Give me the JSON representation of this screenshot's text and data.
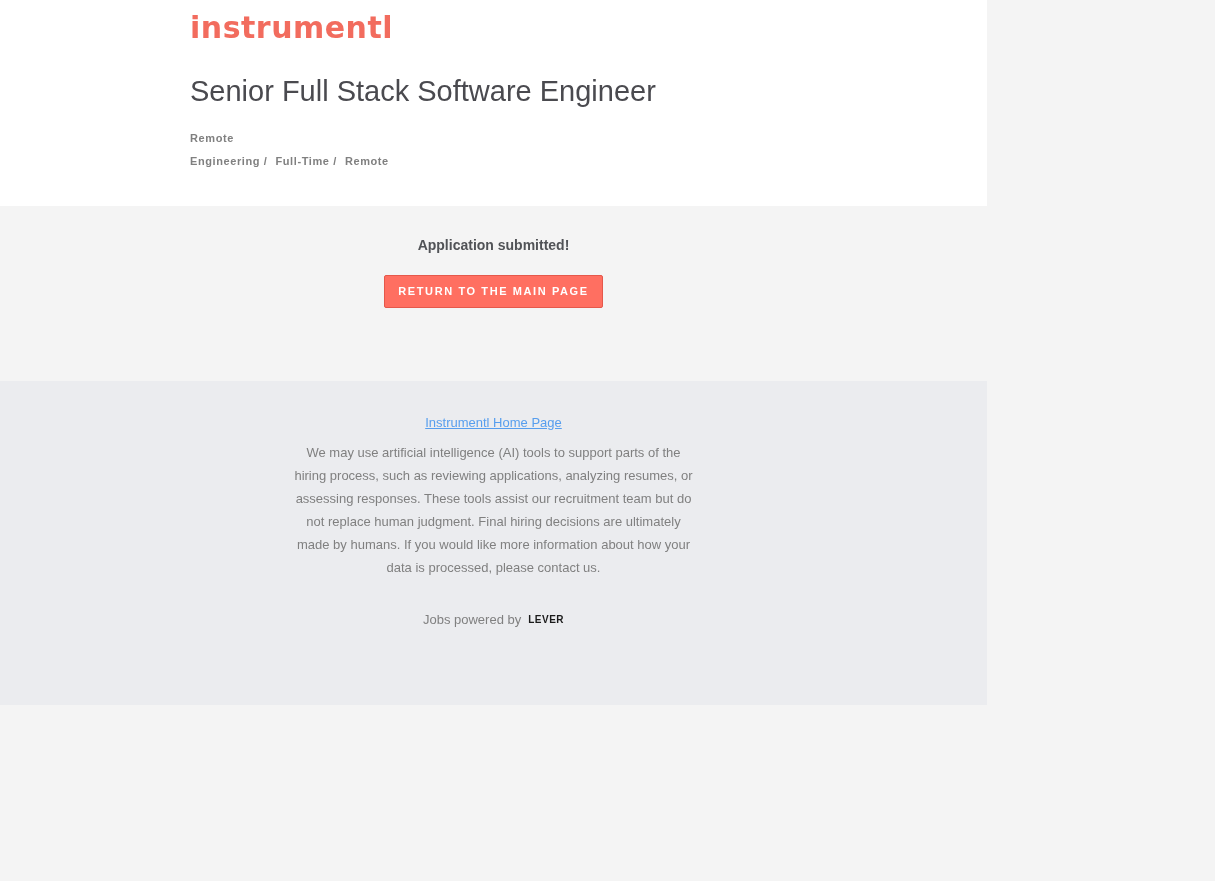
{
  "header": {
    "logo": "instrumentl",
    "title": "Senior Full Stack Software Engineer",
    "location": "Remote",
    "categories": [
      "Engineering /",
      "Full-Time /",
      "Remote"
    ]
  },
  "confirmation": {
    "message": "Application submitted!",
    "button": "RETURN TO THE MAIN PAGE"
  },
  "footer": {
    "link": "Instrumentl Home Page",
    "notice": "We may use artificial intelligence (AI) tools to support parts of the hiring process, such as reviewing applications, analyzing resumes, or assessing responses. These tools assist our recruitment team but do not replace human judgment. Final hiring decisions are ultimately made by humans. If you would like more information about how your data is processed, please contact us.",
    "powered_by": "Jobs powered by",
    "brand": "LEVER"
  }
}
